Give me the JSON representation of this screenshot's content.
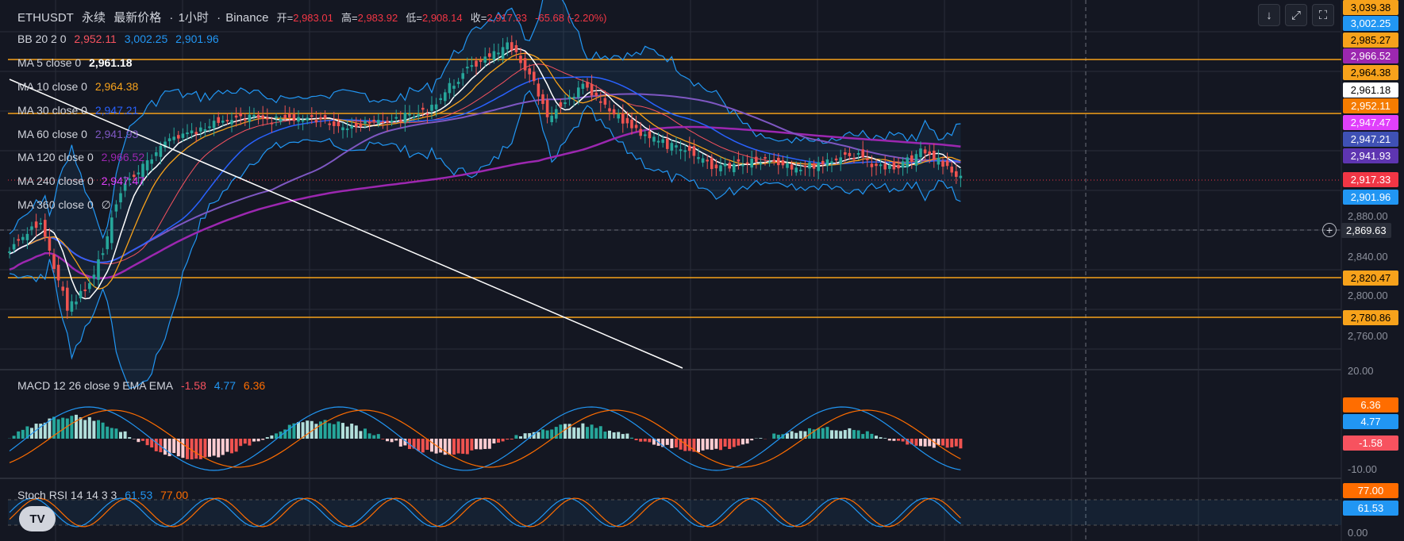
{
  "header": {
    "symbol": "ETHUSDT",
    "perp": "永续",
    "price_type": "最新价格",
    "interval": "1小时",
    "exchange": "Binance",
    "open_label": "开=",
    "open": "2,983.01",
    "high_label": "高=",
    "high": "2,983.92",
    "low_label": "低=",
    "low": "2,908.14",
    "close_label": "收=",
    "close": "2,917.33",
    "change": "-65.68 (-2.20%)"
  },
  "toolbar": {
    "down_icon": "arrow-down-icon",
    "expand_icon": "expand-icon",
    "fullscreen_icon": "fullscreen-icon"
  },
  "indicators": {
    "bb": {
      "label": "BB 20 2 0",
      "basis": "2,952.11",
      "upper": "3,002.25",
      "lower": "2,901.96"
    },
    "ma5": {
      "label": "MA 5 close 0",
      "value": "2,961.18"
    },
    "ma10": {
      "label": "MA 10 close 0",
      "value": "2,964.38"
    },
    "ma30": {
      "label": "MA 30 close 0",
      "value": "2,947.21"
    },
    "ma60": {
      "label": "MA 60 close 0",
      "value": "2,941.93"
    },
    "ma120": {
      "label": "MA 120 close 0",
      "value": "2,966.52"
    },
    "ma240": {
      "label": "MA 240 close 0",
      "value": "2,947.47"
    },
    "ma360": {
      "label": "MA 360 close 0",
      "value": "∅"
    },
    "macd": {
      "label": "MACD 12 26 close 9 EMA EMA",
      "hist": "-1.58",
      "macd": "4.77",
      "signal": "6.36"
    },
    "stoch": {
      "label": "Stoch RSI 14 14 3 3",
      "k": "61.53",
      "d": "77.00"
    }
  },
  "price_axis": {
    "ticks": [
      "2,880.00",
      "2,840.00",
      "2,800.00",
      "2,760.00"
    ],
    "tags": [
      {
        "value": "3,039.38",
        "color": "#f7a21b",
        "text_color": "#000"
      },
      {
        "value": "3,002.25",
        "color": "#2196f3",
        "text_color": "#fff"
      },
      {
        "value": "2,985.27",
        "color": "#f7a21b",
        "text_color": "#000"
      },
      {
        "value": "2,966.52",
        "color": "#9c27b0",
        "text_color": "#fff"
      },
      {
        "value": "2,964.38",
        "color": "#f7a21b",
        "text_color": "#000"
      },
      {
        "value": "2,961.18",
        "color": "#ffffff",
        "text_color": "#000"
      },
      {
        "value": "2,952.11",
        "color": "#f57c00",
        "text_color": "#fff"
      },
      {
        "value": "2,947.47",
        "color": "#e040fb",
        "text_color": "#fff"
      },
      {
        "value": "2,947.21",
        "color": "#3f51b5",
        "text_color": "#fff"
      },
      {
        "value": "2,941.93",
        "color": "#5e35b1",
        "text_color": "#fff"
      },
      {
        "value": "2,917.33",
        "color": "#f23645",
        "text_color": "#fff"
      },
      {
        "value": "2,901.96",
        "color": "#2196f3",
        "text_color": "#fff"
      },
      {
        "value": "2,820.47",
        "color": "#f7a21b",
        "text_color": "#000"
      },
      {
        "value": "2,780.86",
        "color": "#f7a21b",
        "text_color": "#000"
      }
    ],
    "crosshair": "2,869.63"
  },
  "macd_axis": {
    "ticks": [
      "20.00",
      "-10.00"
    ],
    "tags": [
      {
        "value": "6.36",
        "color": "#ff6d00",
        "text_color": "#fff"
      },
      {
        "value": "4.77",
        "color": "#2196f3",
        "text_color": "#fff"
      },
      {
        "value": "-1.58",
        "color": "#f7525f",
        "text_color": "#fff"
      }
    ]
  },
  "stoch_axis": {
    "ticks": [
      "0.00"
    ],
    "tags": [
      {
        "value": "77.00",
        "color": "#ff6d00",
        "text_color": "#fff"
      },
      {
        "value": "61.53",
        "color": "#2196f3",
        "text_color": "#fff"
      }
    ]
  },
  "logo": "TV",
  "colors": {
    "up": "#26a69a",
    "down": "#ef5350",
    "grid": "#2a2e39",
    "level_line": "#f7a21b",
    "ma5": "#ffffff",
    "ma10": "#f7a21b",
    "ma30": "#2962ff",
    "ma60": "#7e57c2",
    "ma120": "#9c27b0",
    "bb": "#2196f3"
  }
}
